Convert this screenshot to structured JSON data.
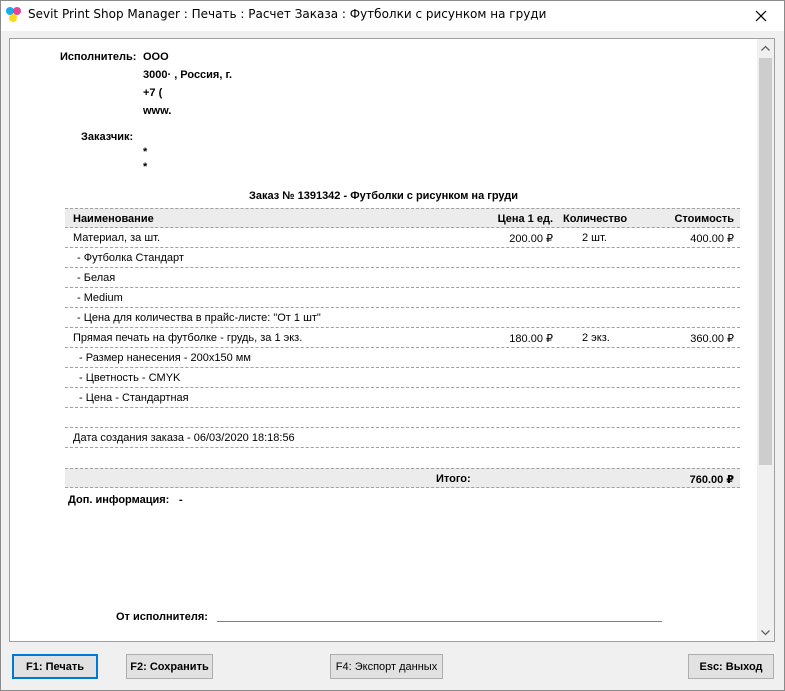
{
  "window": {
    "title": "Sevit Print Shop Manager : Печать : Расчет Заказа : Футболки с рисунком на груди"
  },
  "header": {
    "contractor_label": "Исполнитель:",
    "contractor_lines": [
      "ООО",
      "3000· , Россия, г.",
      "+7 (",
      "www."
    ],
    "customer_label": "Заказчик:",
    "customer_lines": [
      "*",
      "*"
    ]
  },
  "order": {
    "title": "Заказ № 1391342 - Футболки с рисунком на груди"
  },
  "table": {
    "columns": {
      "name": "Наименование",
      "price": "Цена 1 ед.",
      "qty": "Количество",
      "cost": "Стоимость"
    },
    "items": [
      {
        "name": "Материал, за шт.",
        "price": "200.00 ₽",
        "qty": "2 шт.",
        "cost": "400.00 ₽",
        "details": [
          "- Футболка Стандарт",
          "- Белая",
          "- Medium",
          "- Цена для количества в прайс-листе: \"От 1 шт\""
        ]
      },
      {
        "name": "Прямая печать на футболке - грудь, за 1 экз.",
        "price": "180.00 ₽",
        "qty": "2 экз.",
        "cost": "360.00 ₽",
        "details": [
          "- Размер нанесения - 200x150 мм",
          "- Цветность - CMYK",
          "- Цена - Стандартная"
        ]
      }
    ],
    "created": "Дата создания заказа - 06/03/2020 18:18:56",
    "total_label": "Итого:",
    "total_value": "760.00 ₽"
  },
  "extra": {
    "label": "Доп. информация:",
    "value": "-"
  },
  "signature": {
    "label": "От исполнителя:"
  },
  "buttons": {
    "print": "F1: Печать",
    "save": "F2: Сохранить",
    "export": "F4: Экспорт данных",
    "exit": "Esc: Выход"
  },
  "colors": {
    "accent_focus": "#0078d7",
    "icon_cyan": "#00a2e8",
    "icon_magenta": "#e6308a",
    "icon_yellow": "#ffd400"
  }
}
